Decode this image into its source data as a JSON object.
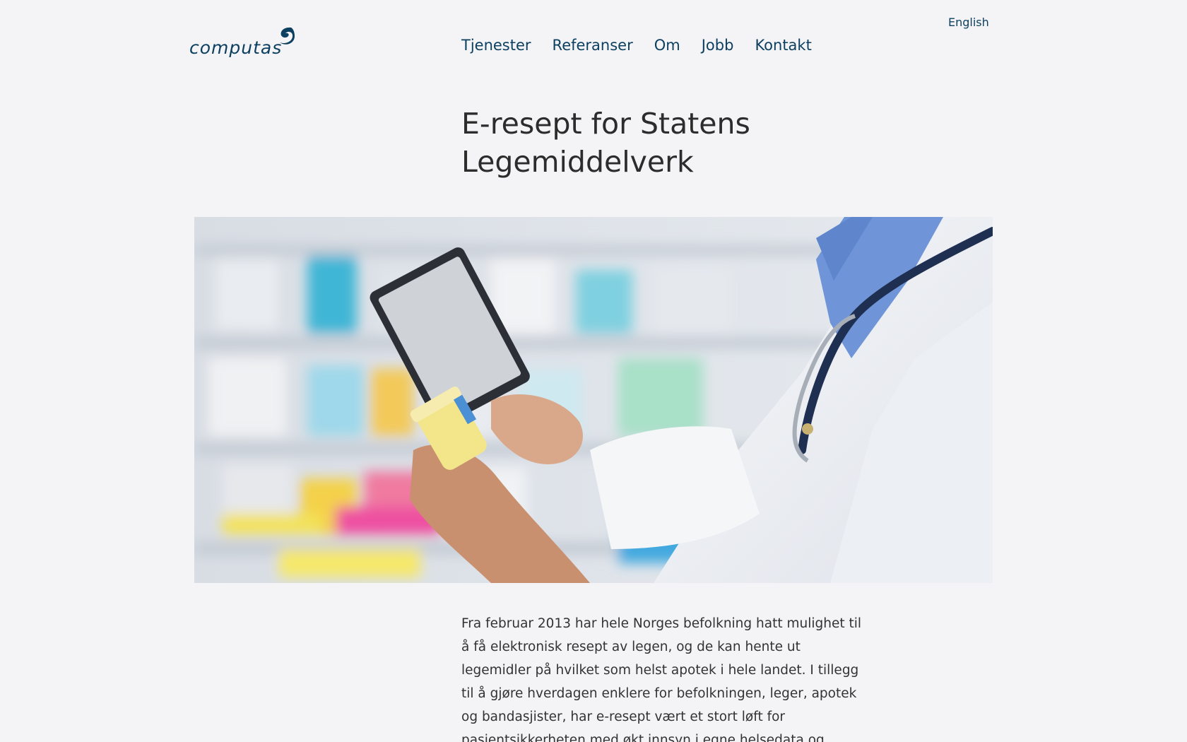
{
  "header": {
    "language_link": "English",
    "logo_text": "computas",
    "nav": [
      {
        "label": "Tjenester"
      },
      {
        "label": "Referanser"
      },
      {
        "label": "Om"
      },
      {
        "label": "Jobb"
      },
      {
        "label": "Kontakt"
      }
    ]
  },
  "article": {
    "title": "E-resept for Statens Legemiddelverk",
    "body": "Fra februar 2013 har hele Norges befolkning hatt mulighet til å få elektronisk resept av legen, og de kan hente ut legemidler på hvilket som helst apotek i hele landet. I tillegg til å gjøre hverdagen enklere for befolkningen, leger, apotek og bandasjister, har e-resept vært et stort løft for pasientsikkerheten med økt innsyn i egne helsedata og redusert"
  },
  "colors": {
    "brand": "#0d4060",
    "text": "#333333",
    "background": "#f4f4f6"
  },
  "icons": {
    "logo_mark": "computas-swirl-icon"
  }
}
